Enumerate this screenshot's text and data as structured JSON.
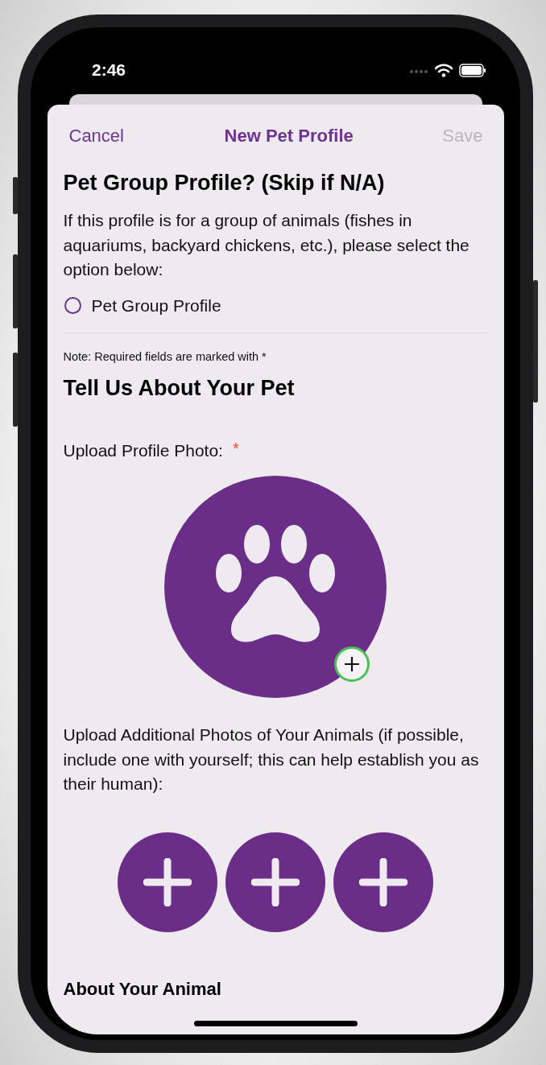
{
  "status_bar": {
    "time": "2:46"
  },
  "nav": {
    "cancel": "Cancel",
    "title": "New Pet Profile",
    "save": {
      "label": "Save",
      "disabled": true
    }
  },
  "group_section": {
    "heading": "Pet Group Profile? (Skip if N/A)",
    "description": "If this profile is for a group of animals (fishes in aquariums, backyard chickens, etc.), please select the option below:",
    "option": {
      "label": "Pet Group Profile",
      "selected": false
    }
  },
  "note": "Note: Required fields are marked with *",
  "heading": "Tell Us About Your Pet",
  "profile_photo": {
    "label": "Upload Profile Photo:",
    "required_mark": "*"
  },
  "additional_photos": {
    "label": "Upload Additional Photos of Your Animals (if possible, include one with yourself; this can help establish you as their human):",
    "slots": [
      {
        "kind": "empty"
      },
      {
        "kind": "empty"
      },
      {
        "kind": "empty"
      }
    ]
  },
  "next_heading": "About Your Animal"
}
